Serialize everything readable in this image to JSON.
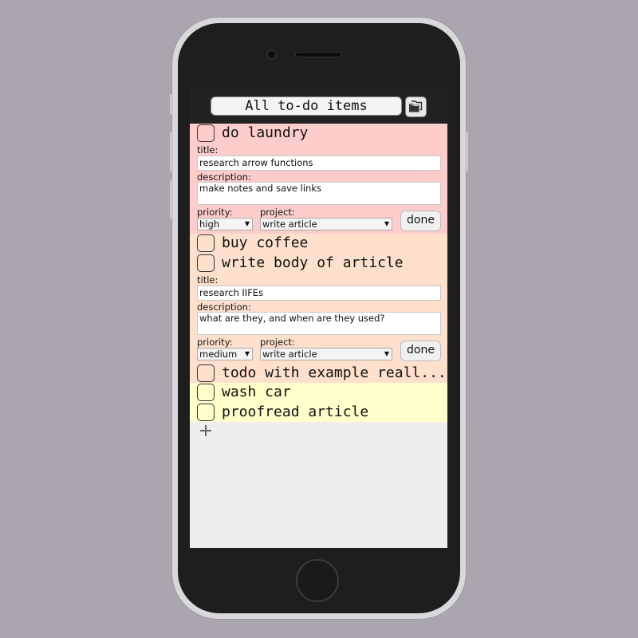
{
  "header": {
    "title": "All to-do items",
    "view_icon": "folders-icon"
  },
  "items": [
    {
      "title": "do laundry",
      "color": "#ffcccc",
      "expanded": true,
      "title_label": "title:",
      "title_value": "research arrow functions",
      "description_label": "description:",
      "description_value": "make notes and save links",
      "priority_label": "priority:",
      "priority_value": "high",
      "project_label": "project:",
      "project_value": "write article",
      "done_label": "done"
    },
    {
      "title": "buy coffee",
      "color": "#ffe0cc",
      "expanded": false
    },
    {
      "title": "write body of article",
      "color": "#ffe0cc",
      "expanded": true,
      "title_label": "title:",
      "title_value": "research IIFEs",
      "description_label": "description:",
      "description_value": "what are they, and when are they used?",
      "priority_label": "priority:",
      "priority_value": "medium",
      "project_label": "project:",
      "project_value": "write article",
      "done_label": "done"
    },
    {
      "title": "todo with example reall...",
      "color": "#ffe0cc",
      "expanded": false
    },
    {
      "title": "wash car",
      "color": "#ffffcc",
      "expanded": false
    },
    {
      "title": "proofread article",
      "color": "#ffffcc",
      "expanded": false
    }
  ],
  "add_icon": "plus-icon",
  "colors": {
    "background": "#aba5b0",
    "screen": "#eeeeee",
    "topbar": "#222222"
  }
}
